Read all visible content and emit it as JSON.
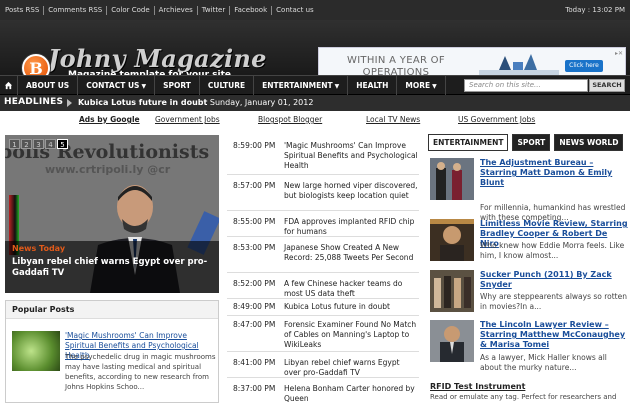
{
  "top_links": [
    "Posts RSS",
    "Comments RSS",
    "Color Code",
    "Archieves",
    "Twitter",
    "Facebook",
    "Contact us"
  ],
  "top_date": "Today : 13:02 PM",
  "logo": {
    "letter": "B",
    "title": "Johny Magazine",
    "tagline": "Magazine template for your site"
  },
  "banner": {
    "text_line1": "WITHIN A YEAR OF",
    "text_line2": "OPERATIONS",
    "button": "Click here"
  },
  "nav": {
    "items": [
      {
        "label": "ABOUT US",
        "caret": ""
      },
      {
        "label": "CONTACT US",
        "caret": "▼"
      },
      {
        "label": "SPORT",
        "caret": ""
      },
      {
        "label": "CULTURE",
        "caret": ""
      },
      {
        "label": "ENTERTAINMENT",
        "caret": "▼"
      },
      {
        "label": "HEALTH",
        "caret": ""
      },
      {
        "label": "MORE",
        "caret": "▼"
      }
    ],
    "search_placeholder": "Search on this site...",
    "search_button": "SEARCH"
  },
  "headlines": {
    "label": "HEADLINES",
    "title": "Kubica Lotus future in doubt",
    "date": "Sunday, January 01, 2012"
  },
  "ad_links": [
    "Ads by Google",
    "Government Jobs",
    "Blogspot Blogger",
    "Local TV News",
    "US Government Jobs"
  ],
  "slider": {
    "pages": [
      "1",
      "2",
      "3",
      "4",
      "5"
    ],
    "active_page": 5,
    "bg_text": "bolis Revolutionists",
    "bg_url": "www.crtripoli.ly    @cr",
    "category": "News Today",
    "title": "Libyan rebel chief warns Egypt over pro-Gaddafi TV"
  },
  "popular": {
    "heading": "Popular Posts",
    "title": "'Magic Mushrooms' Can Improve Spiritual Benefits and Psychological Health",
    "desc": "The psychedelic drug in magic mushrooms may have lasting medical and spiritual benefits, according to new research from Johns Hopkins Schoo..."
  },
  "timeline": [
    {
      "time": "8:59:00 PM",
      "text": "'Magic Mushrooms' Can Improve Spiritual Benefits and Psychological Health"
    },
    {
      "time": "8:57:00 PM",
      "text": "New large horned viper discovered, but biologists keep location quiet"
    },
    {
      "time": "8:55:00 PM",
      "text": "FDA approves implanted RFID chip for humans"
    },
    {
      "time": "8:53:00 PM",
      "text": "Japanese Show Created A New Record: 25,088 Tweets Per Second"
    },
    {
      "time": "8:52:00 PM",
      "text": "A few Chinese hacker teams do most US data theft"
    },
    {
      "time": "8:49:00 PM",
      "text": "Kubica Lotus future in doubt"
    },
    {
      "time": "8:47:00 PM",
      "text": "Forensic Examiner Found No Match of Cables on Manning's Laptop to WikiLeaks"
    },
    {
      "time": "8:41:00 PM",
      "text": "Libyan rebel chief warns Egypt over pro-Gaddafi TV"
    },
    {
      "time": "8:37:00 PM",
      "text": "Helena Bonham Carter honored by Queen"
    }
  ],
  "tabs": [
    "ENTERTAINMENT",
    "SPORT",
    "NEWS WORLD"
  ],
  "right_posts": [
    {
      "title": "The Adjustment Bureau – Starring Matt Damon & Emily Blunt",
      "desc": "For millennia, humankind has wrestled with these competing..."
    },
    {
      "title": "Limitless Movie Review, Starring Bradley Cooper & Robert De Niro",
      "desc": "Who knew how Eddie Morra feels. Like him, I know almost..."
    },
    {
      "title": "Sucker Punch (2011) By Zack Snyder",
      "desc": "Why are steppearents always so rotten in movies?In a..."
    },
    {
      "title": "The Lincoln Lawyer Review – Starring Matthew McConaughey & Marisa Tomei",
      "desc": "As a lawyer, Mick Haller knows all about the murky nature..."
    }
  ],
  "rfid": {
    "title": "RFID Test Instrument",
    "desc": "Read or emulate any tag. Perfect for researchers and"
  }
}
